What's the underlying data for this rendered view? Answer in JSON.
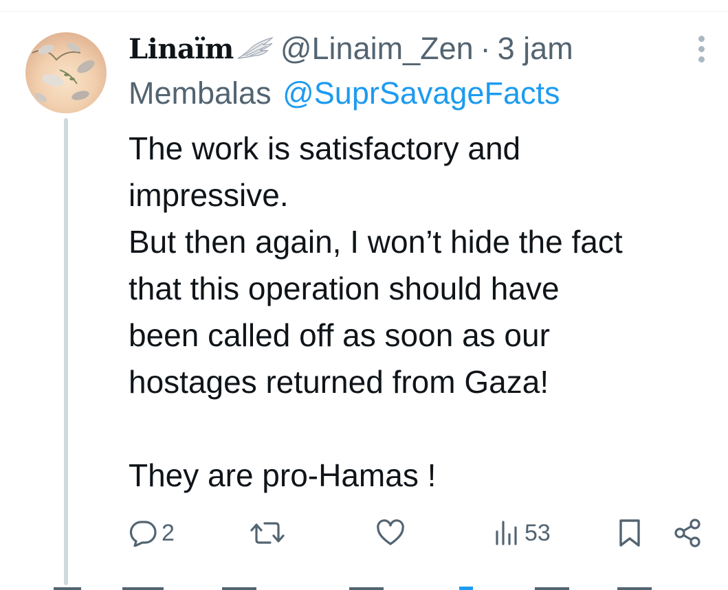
{
  "tweet": {
    "display_name": "Linaïm",
    "handle": "@Linaim_Zen",
    "separator": "·",
    "time": "3 jam",
    "reply_prefix": "Membalas",
    "reply_to": "@SuprSavageFacts",
    "lines": [
      "The work is satisfactory and",
      "impressive.",
      "But then again, I won’t hide the fact",
      "that this operation should have",
      "been called off as soon as our",
      "hostages returned from Gaza!",
      "They are pro-Hamas !"
    ]
  },
  "actions": {
    "reply_icon": "reply-bubble-icon",
    "reply_count": "2",
    "retweet_icon": "retweet-icon",
    "like_icon": "heart-icon",
    "views_icon": "views-bar-chart-icon",
    "views_count": "53",
    "bookmark_icon": "bookmark-icon",
    "share_icon": "share-icon"
  },
  "colors": {
    "text": "#0f1419",
    "secondary": "#536471",
    "link": "#1d9bf0",
    "thread_line": "#cfd9de"
  }
}
